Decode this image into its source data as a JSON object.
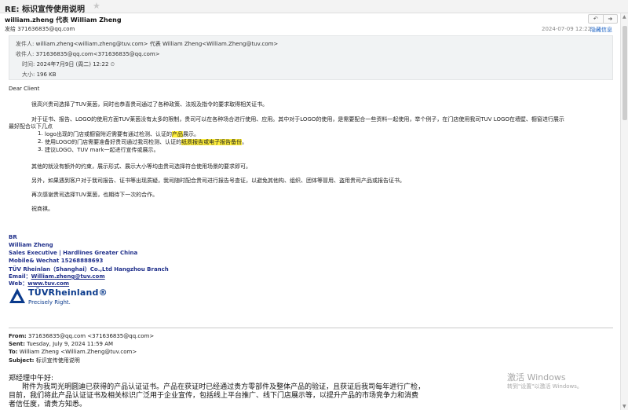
{
  "window": {
    "title": "RE: 标识宣传使用说明"
  },
  "header": {
    "sender": "william.zheng 代表 William Zheng",
    "sent_to_label": "发给",
    "sent_to": "371636835@qq.com",
    "datetime": "2024-07-09 12:22",
    "hide_info": "隐藏信息",
    "actions": [
      "↶",
      "➜"
    ]
  },
  "details": {
    "from_label": "发件人:",
    "from": "william.zheng<william.zheng@tuv.com> 代表 William Zheng<William.Zheng@tuv.com>",
    "to_label": "收件人:",
    "to": "371636835@qq.com<371636835@qq.com>",
    "time_label": "时间:",
    "time": "2024年7月9日 (周二) 12:22",
    "size_label": "大小:",
    "size": "196 KB"
  },
  "body": {
    "greeting": "Dear Client",
    "p1": "很高兴贵司选择了TUV莱茵，同时也恭喜贵司通过了各种政策、法规及指令的要求取得相关证书。",
    "p2a": "对于证书、报告、LOGO的使用方面TUV莱茵没有太多的限制，贵司可以在各种场合进行使用、应用。其中对于LOGO的使用，是需要配合一些资料一起使用，举个例子，在门店使用我司TUV LOGO在墙壁、橱窗进行展示",
    "p2b": "最好配合以下几点",
    "items": [
      {
        "num": "1.",
        "pre": "logo出现的门店或橱窗附近需要有通过检测、认证的",
        "hl": "产品",
        "post": "展示。"
      },
      {
        "num": "2.",
        "pre": "使用LOGO的门店需要准备好贵司通过我司检测、认证的",
        "hl": "纸质报告或电子报告备份",
        "post": "。"
      },
      {
        "num": "3.",
        "pre": "建议LOGO、TUV mark一起进行宣传或展示。",
        "hl": "",
        "post": ""
      }
    ],
    "p3": "其他的就没有额外的约束，展示形式、展示大小等均由贵司选择符合使用场景的要求即可。",
    "p4": "另外，如果遇到客户对于我司报告、证书等出现质疑，我司随时配合贵司进行报告号查证，以避免其他构、组织、团体等冒用、盗用贵司产品或报告证书。",
    "p5": "再次感谢贵司选择TUV莱茵，也期待下一次的合作。",
    "p6": "祝商祺。"
  },
  "signature": {
    "br": "BR",
    "name": "William Zheng",
    "title": "Sales Executive | Hardlines Greater China",
    "mobile": "Mobile& Wechat 15268888693",
    "company": "TÜV Rheinlan（Shanghai）Co.,Ltd Hangzhou Branch",
    "email_label": "Email：",
    "email": "William.zheng@tuv.com",
    "web_label": "Web：",
    "web": "www.tuv.com",
    "logo_brand": "TÜVRheinland®",
    "logo_tag": "Precisely Right."
  },
  "forwarded": {
    "from_label": "From:",
    "from": "371636835@qq.com <371636835@qq.com>",
    "sent_label": "Sent:",
    "sent": "Tuesday, July 9, 2024 11:59 AM",
    "to_label": "To:",
    "to": "William Zheng <William.Zheng@tuv.com>",
    "subject_label": "Subject:",
    "subject": "标识宣传使用说明",
    "line1": "郑经理中午好:",
    "line2": "      附件为我司光明圆迪已获得的产品认证证书。产品在获证时已经通过贵方零部件及整体产品的验证，且获证后我司每年进行广检，",
    "line3": "目前，我们将此产品认证证书及相关标识广泛用于企业宣传，包括线上平台推广、线下门店展示等，以提升产品的市场竞争力和消费",
    "line4": "者信任度，请贵方知悉。"
  },
  "watermark": {
    "line1": "激活 Windows",
    "line2": "转到\"设置\"以激活 Windows。"
  }
}
